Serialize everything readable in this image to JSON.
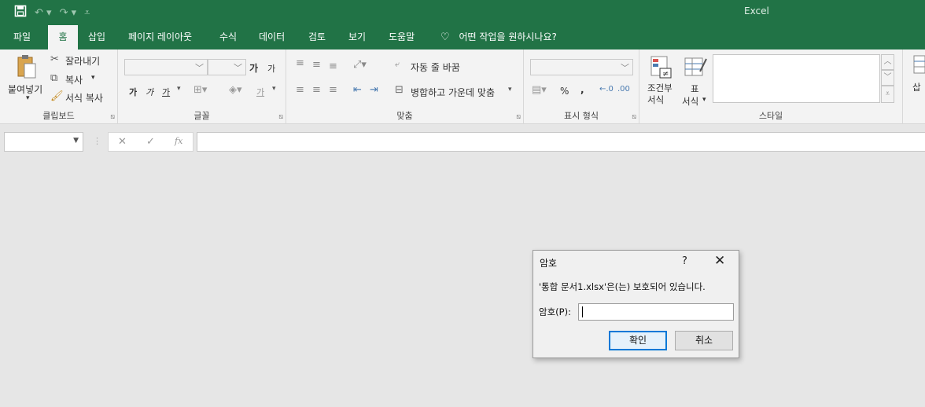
{
  "window": {
    "app_title": "Excel"
  },
  "qat": {
    "save_icon": "save-icon",
    "undo_icon": "undo-icon",
    "redo_icon": "redo-icon",
    "customize_icon": "customize-icon"
  },
  "tabs": [
    {
      "label": "파일"
    },
    {
      "label": "홈"
    },
    {
      "label": "삽입"
    },
    {
      "label": "페이지 레이아웃"
    },
    {
      "label": "수식"
    },
    {
      "label": "데이터"
    },
    {
      "label": "검토"
    },
    {
      "label": "보기"
    },
    {
      "label": "도움말"
    },
    {
      "label": "어떤 작업을 원하시나요?"
    }
  ],
  "ribbon": {
    "clipboard": {
      "label": "클립보드",
      "paste": "붙여넣기",
      "cut": "잘라내기",
      "copy": "복사",
      "format_painter": "서식 복사"
    },
    "font": {
      "label": "글꼴",
      "bold": "가",
      "italic": "가",
      "underline": "가",
      "grow": "가",
      "shrink": "가",
      "font_color": "가"
    },
    "alignment": {
      "label": "맞춤",
      "wrap": "자동 줄 바꿈",
      "merge": "병합하고 가운데 맞춤"
    },
    "number": {
      "label": "표시 형식",
      "percent": "%",
      "comma": ","
    },
    "styles": {
      "label": "스타일",
      "conditional": "조건부 서식",
      "table_line1": "표",
      "table_line2": "서식"
    },
    "cells": {
      "insert": "삽"
    }
  },
  "formula_bar": {
    "cancel": "✕",
    "enter": "✓",
    "fx": "fx"
  },
  "dialog": {
    "title": "암호",
    "help": "?",
    "close": "✕",
    "message": "'통합 문서1.xlsx'은(는) 보호되어 있습니다.",
    "password_label": "암호(P):",
    "password_value": "",
    "ok": "확인",
    "cancel": "취소"
  },
  "colors": {
    "accent": "#217346",
    "dialog_bg": "#f0f0f0",
    "ok_border": "#0078d7"
  }
}
